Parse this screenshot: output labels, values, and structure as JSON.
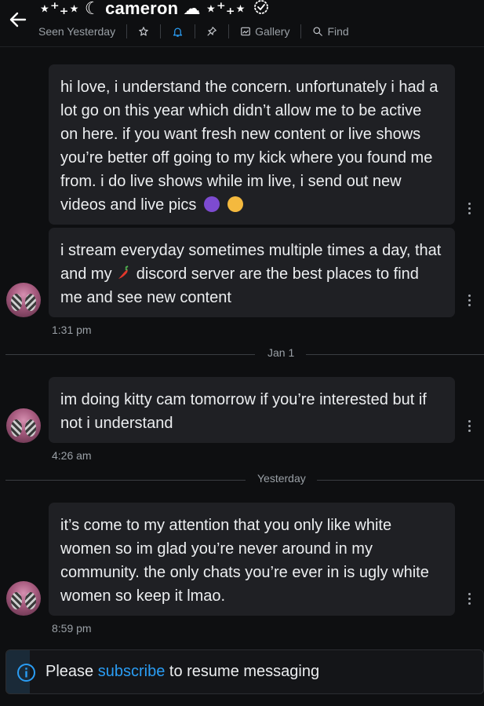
{
  "header": {
    "title": "⋆⁺₊⋆ ☾ cameron ☁︎ ⋆⁺₊⋆",
    "seen": "Seen Yesterday",
    "gallery_label": "Gallery",
    "find_label": "Find"
  },
  "messages": [
    {
      "text": "hi love, i understand the concern. unfortunately i had a lot go on this year which didn’t allow me to be active on here. if you want fresh new content or live shows you’re better off going to my kick where you found me from. i do live shows while im live, i send out new videos and live pics"
    },
    {
      "text_a": "i stream everyday sometimes multiple times a day, that and my",
      "text_b": "discord server are the best places to find me and see new content",
      "time": "1:31 pm"
    },
    {
      "text": "im doing kitty cam tomorrow if you’re interested but if not i understand",
      "time": "4:26 am"
    },
    {
      "text": "it’s come to my attention that you only like white women so im glad you’re never around in my community. the only chats you’re ever in is ugly white women so keep it lmao.",
      "time": "8:59 pm"
    }
  ],
  "dividers": {
    "jan1": "Jan 1",
    "yesterday": "Yesterday"
  },
  "footer": {
    "prefix": "Please",
    "link": "subscribe",
    "suffix": "to resume messaging"
  },
  "colors": {
    "accent": "#2a9df4",
    "bubble": "#1f2024",
    "background": "#0e0f11"
  }
}
